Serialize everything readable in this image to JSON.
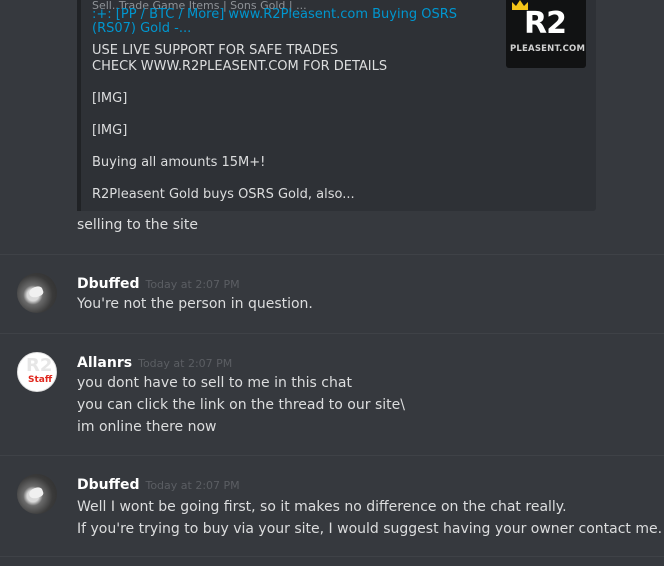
{
  "embed": {
    "provider": "Sell..Trade Game Items | Sons Gold | ...",
    "title": ":+: [PP / BTC / More] www.R2Pleasent.com Buying OSRS (RS07) Gold -...",
    "lines": [
      "USE LIVE SUPPORT FOR SAFE TRADES",
      "CHECK WWW.R2PLEASENT.COM FOR DETAILS",
      "",
      "[IMG]",
      "",
      "[IMG]",
      "",
      "Buying all amounts 15M+!",
      "",
      "R2Pleasent Gold buys OSRS Gold, also..."
    ],
    "thumbnail": {
      "logo": "R2",
      "subtitle": "PLEASENT.COM"
    }
  },
  "continuation": "selling to the site",
  "messages": [
    {
      "username": "Dbuffed",
      "timestamp": "Today at 2:07 PM",
      "lines": [
        "You're not the person in question."
      ]
    },
    {
      "username": "Allanrs",
      "timestamp": "Today at 2:07 PM",
      "avatar_text": {
        "main": "R2",
        "sub": "Staff"
      },
      "lines": [
        "you dont have to sell to me in this chat",
        "you can click the link on the thread to our site\\",
        "im online there now"
      ]
    },
    {
      "username": "Dbuffed",
      "timestamp": "Today at 2:07 PM",
      "lines": [
        "Well I wont be going first, so it makes no difference on the chat really.",
        "If you're trying to buy via your site, I would suggest having your owner contact me."
      ]
    }
  ],
  "colors": {
    "background": "#36393e",
    "embed_background": "#2e3136",
    "link": "#0096cf",
    "username": "#ffffff",
    "timestamp": "#5b5e63"
  }
}
